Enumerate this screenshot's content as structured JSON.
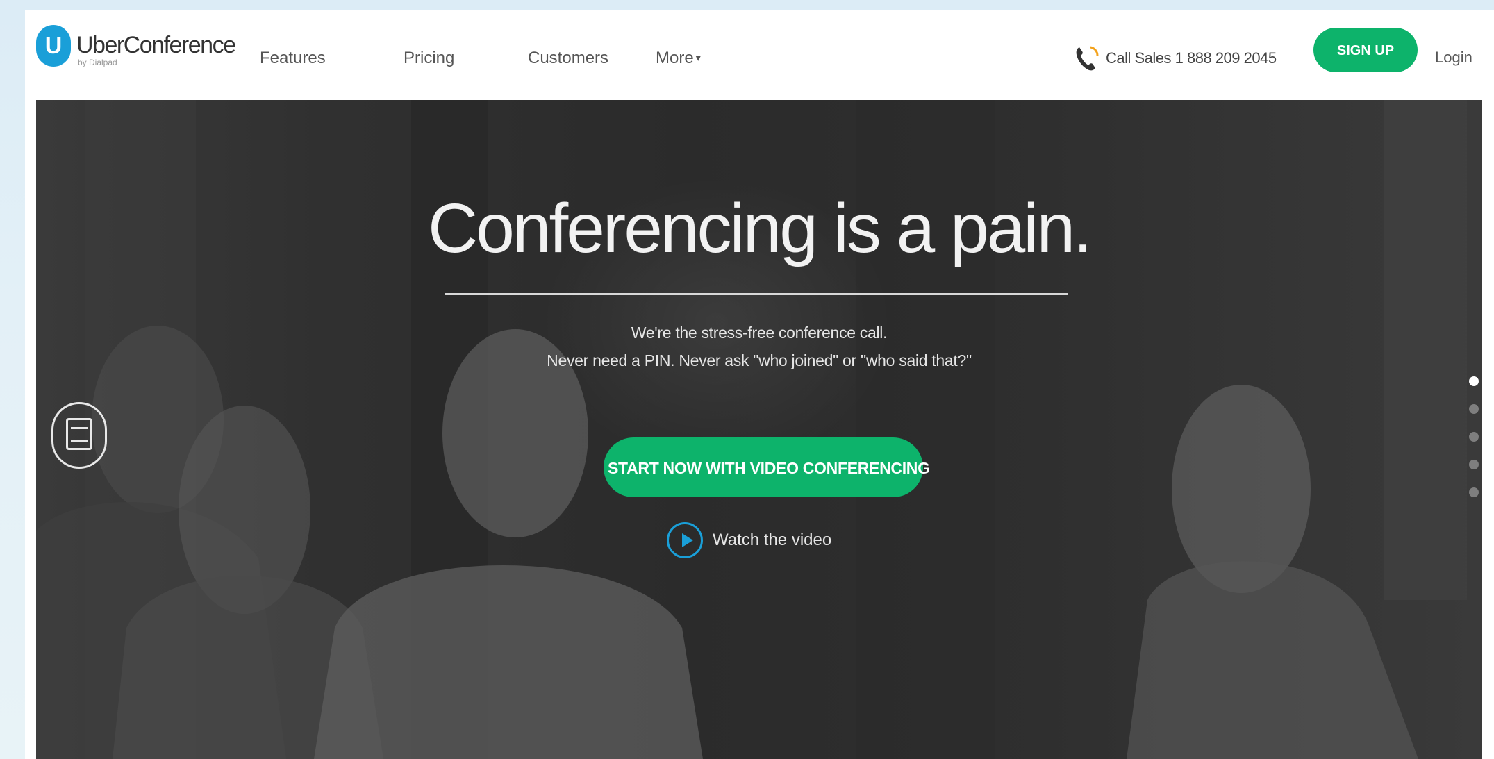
{
  "brand": {
    "logo_letter": "U",
    "name": "UberConference",
    "byline": "by Dialpad",
    "colors": {
      "green": "#0db36b",
      "blue": "#1a9fd8"
    }
  },
  "nav": {
    "items": [
      {
        "label": "Features"
      },
      {
        "label": "Pricing"
      },
      {
        "label": "Customers"
      },
      {
        "label": "More",
        "caret": "▾"
      }
    ]
  },
  "header": {
    "phone_icon": "phone-icon",
    "phone_text": "Call Sales 1 888 209 2045",
    "signup_label": "SIGN UP",
    "login_label": "Login"
  },
  "hero": {
    "title": "Conferencing is a pain.",
    "subtitle_line1": "We're the stress-free conference call.",
    "subtitle_line2": "Never need a PIN. Never ask \"who joined\" or \"who said that?\"",
    "cta_label": "START NOW WITH VIDEO CONFERENCING",
    "watch_label": "Watch the video",
    "carousel": {
      "total": 5,
      "active": 1
    }
  }
}
